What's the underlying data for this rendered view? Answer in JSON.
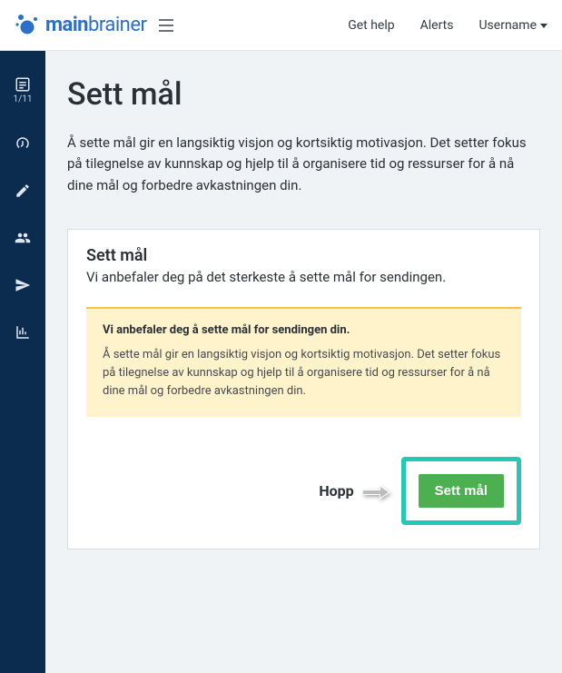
{
  "header": {
    "brand_main": "main",
    "brand_sub": "brainer",
    "help_label": "Get help",
    "alerts_label": "Alerts",
    "username_label": "Username"
  },
  "sidebar": {
    "step_label": "1/11"
  },
  "page": {
    "title": "Sett mål",
    "intro": "Å sette mål gir en langsiktig visjon og kortsiktig motivasjon. Det setter fokus på tilegnelse av kunnskap og hjelp til å organisere tid og ressurser for å nå dine mål og forbedre avkastningen din."
  },
  "card": {
    "title": "Sett mål",
    "subtitle": "Vi anbefaler deg på det sterkeste å sette mål for sendingen."
  },
  "alert": {
    "title": "Vi anbefaler deg å sette mål for sendingen din.",
    "body": "Å sette mål gir en langsiktig visjon og kortsiktig motivasjon. Det setter fokus på tilegnelse av kunnskap og hjelp til å organisere tid og ressurser for å nå dine mål og forbedre avkastningen din."
  },
  "footer": {
    "skip_label": "Hopp",
    "primary_label": "Sett mål"
  }
}
